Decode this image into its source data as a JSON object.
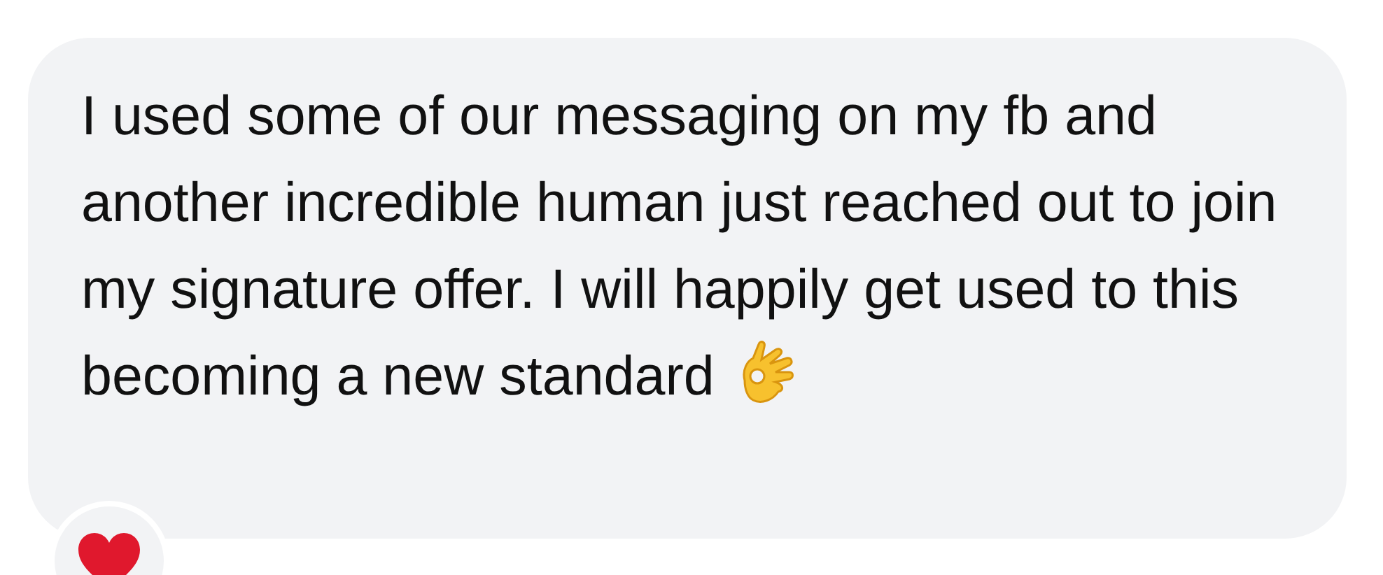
{
  "message": {
    "text": "I used some of our messaging on my fb and another incredible human just reached out to join my signature offer. I will happily get used to this becoming a new standard",
    "reactions": [
      {
        "kind": "heart"
      }
    ]
  }
}
